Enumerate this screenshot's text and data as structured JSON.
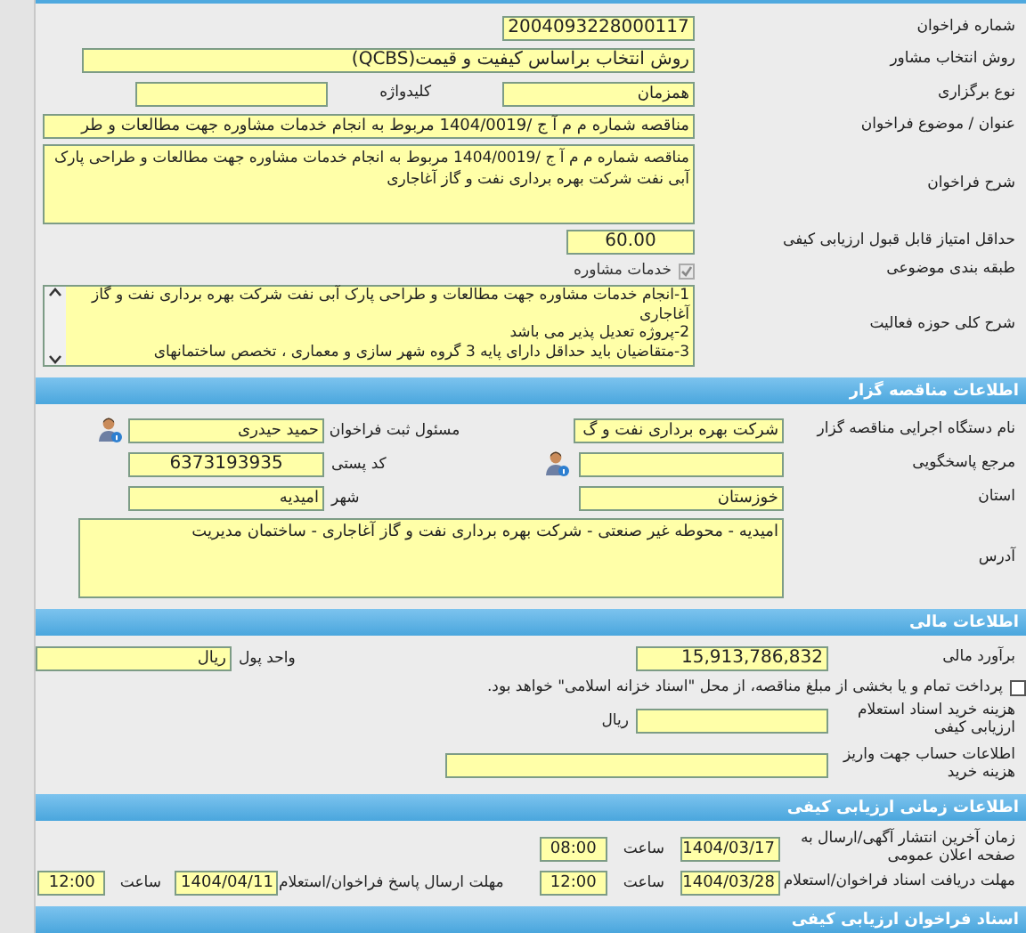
{
  "call_info": {
    "call_number": {
      "label": "شماره فراخوان",
      "value": "2004093228000117"
    },
    "selection_method": {
      "label": "روش انتخاب مشاور",
      "value": "روش انتخاب براساس کیفیت و قیمت(QCBS)"
    },
    "holding_type": {
      "label": "نوع برگزاری",
      "value": "همزمان"
    },
    "keyword": {
      "label": "کلیدواژه"
    },
    "subject": {
      "label": "عنوان / موضوع فراخوان",
      "value": "مناقصه شماره م م آ ج /1404/0019 مربوط به انجام خدمات مشاوره جهت مطالعات و طر"
    },
    "description": {
      "label": "شرح فراخوان",
      "lines": [
        "مناقصه شماره م م آ ج /1404/0019 مربوط به انجام خدمات مشاوره جهت مطالعات و طراحی پارک",
        "آبی نفت شرکت بهره برداری نفت و گاز آغاجاری"
      ]
    },
    "min_score": {
      "label": "حداقل امتیاز قابل قبول ارزیابی کیفی",
      "value": "60.00"
    },
    "category": {
      "label": "طبقه بندی موضوعی",
      "option": "خدمات مشاوره",
      "checked": true,
      "disabled": true
    },
    "activity_scope": {
      "label": "شرح کلی حوزه فعالیت",
      "lines": [
        "1-انجام خدمات مشاوره جهت مطالعات و طراحی پارک آبی نفت شرکت بهره برداری نفت و گاز",
        "آغاجاری",
        "2-پروژه تعدیل پذیر می باشد",
        "3-متقاضیان باید حداقل دارای پایه 3 گروه شهر سازی و معماری ، تخصص ساختمانهای"
      ]
    }
  },
  "organizer": {
    "heading": "اطلاعات مناقصه گزار",
    "agency": {
      "label": "نام دستگاه اجرایی مناقصه گزار",
      "value": "شرکت بهره برداری نفت و گ"
    },
    "registrar": {
      "label": "مسئول ثبت فراخوان",
      "value": "حمید حیدری"
    },
    "responder": {
      "label": "مرجع پاسخگویی"
    },
    "postal_code": {
      "label": "کد پستی",
      "value": "6373193935"
    },
    "province": {
      "label": "استان",
      "value": "خوزستان"
    },
    "city": {
      "label": "شهر",
      "value": "امیدیه"
    },
    "address": {
      "label": "آدرس",
      "value": "امیدیه - محوطه غیر صنعتی - شرکت بهره برداری نفت و گاز آغاجاری - ساختمان مدیریت"
    }
  },
  "financial": {
    "heading": "اطلاعات مالی",
    "estimate": {
      "label": "برآورد مالی",
      "value": "15,913,786,832"
    },
    "currency": {
      "label": "واحد پول",
      "value": "ریال"
    },
    "treasury": {
      "text": "پرداخت تمام و یا بخشی از مبلغ مناقصه، از محل \"اسناد خزانه اسلامی\" خواهد بود.",
      "checked": false
    },
    "document_fee": {
      "label": "هزینه خرید اسناد استعلام ارزیابی کیفی",
      "unit": "ریال"
    },
    "account": {
      "label": "اطلاعات حساب جهت واریز هزینه خرید"
    }
  },
  "timing": {
    "heading": "اطلاعات زمانی ارزیابی کیفی",
    "publish": {
      "label": "زمان آخرین انتشار آگهی/ارسال به صفحه اعلان عمومی",
      "date": "1404/03/17",
      "time_label": "ساعت",
      "time": "08:00"
    },
    "receive": {
      "label": "مهلت دریافت اسناد فراخوان/استعلام",
      "date": "1404/03/28",
      "time_label": "ساعت",
      "time": "12:00"
    },
    "submit": {
      "label": "مهلت ارسال پاسخ فراخوان/استعلام",
      "date": "1404/04/11",
      "time_label": "ساعت",
      "time": "12:00"
    }
  },
  "documents": {
    "heading": "اسناد فراخوان ارزیابی کیفی"
  }
}
